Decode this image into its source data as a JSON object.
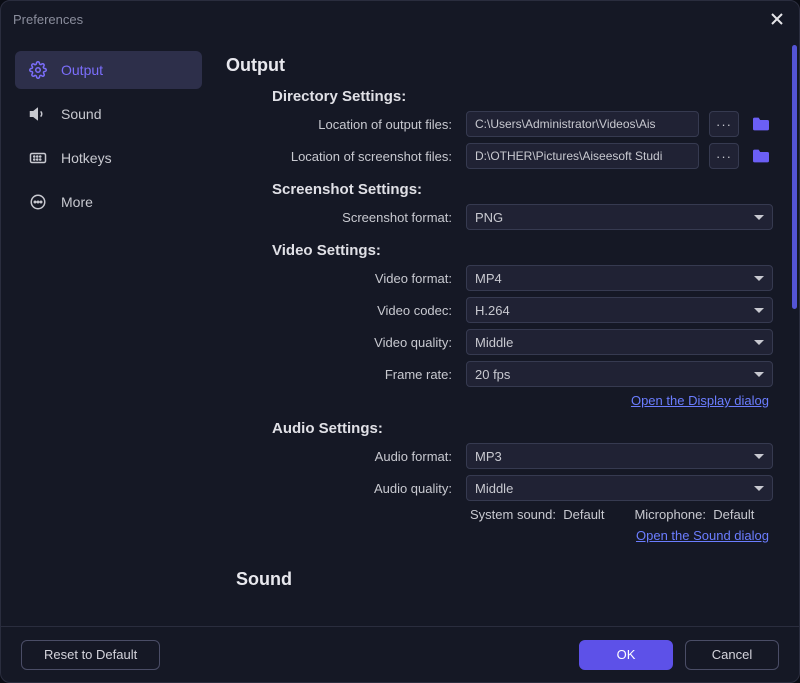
{
  "window": {
    "title": "Preferences"
  },
  "sidebar": {
    "items": [
      {
        "label": "Output"
      },
      {
        "label": "Sound"
      },
      {
        "label": "Hotkeys"
      },
      {
        "label": "More"
      }
    ]
  },
  "output": {
    "title": "Output",
    "directory": {
      "title": "Directory Settings:",
      "output_label": "Location of output files:",
      "output_value": "C:\\Users\\Administrator\\Videos\\Ais",
      "screenshot_label": "Location of screenshot files:",
      "screenshot_value": "D:\\OTHER\\Pictures\\Aiseesoft Studi",
      "more": "···"
    },
    "screenshot": {
      "title": "Screenshot Settings:",
      "format_label": "Screenshot format:",
      "format_value": "PNG"
    },
    "video": {
      "title": "Video Settings:",
      "format_label": "Video format:",
      "format_value": "MP4",
      "codec_label": "Video codec:",
      "codec_value": "H.264",
      "quality_label": "Video quality:",
      "quality_value": "Middle",
      "framerate_label": "Frame rate:",
      "framerate_value": "20 fps",
      "display_link": "Open the Display dialog"
    },
    "audio": {
      "title": "Audio Settings:",
      "format_label": "Audio format:",
      "format_value": "MP3",
      "quality_label": "Audio quality:",
      "quality_value": "Middle",
      "system_sound_label": "System sound:",
      "system_sound_value": "Default",
      "microphone_label": "Microphone:",
      "microphone_value": "Default",
      "sound_link": "Open the Sound dialog"
    }
  },
  "sound": {
    "title": "Sound"
  },
  "footer": {
    "reset": "Reset to Default",
    "ok": "OK",
    "cancel": "Cancel"
  }
}
